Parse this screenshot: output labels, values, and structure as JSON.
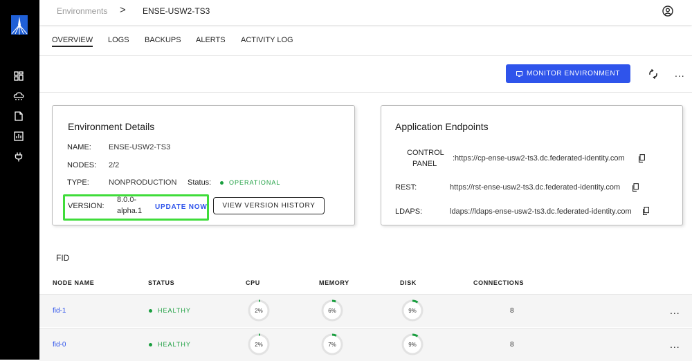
{
  "breadcrumb": {
    "parent": "Environments",
    "separator": ">",
    "current": "ENSE-USW2-TS3"
  },
  "tabs": [
    {
      "label": "OVERVIEW",
      "active": true
    },
    {
      "label": "LOGS"
    },
    {
      "label": "BACKUPS"
    },
    {
      "label": "ALERTS"
    },
    {
      "label": "ACTIVITY LOG"
    }
  ],
  "actions": {
    "monitor_label": "MONITOR ENVIRONMENT",
    "more": "..."
  },
  "env_details": {
    "title": "Environment Details",
    "name_label": "NAME:",
    "name_value": "ENSE-USW2-TS3",
    "nodes_label": "NODES:",
    "nodes_value": "2/2",
    "type_label": "TYPE:",
    "type_value": "NONPRODUCTION",
    "status_label": "Status:",
    "status_value": "OPERATIONAL",
    "version_label": "VERSION:",
    "version_value_line1": "8.0.0-",
    "version_value_line2": "alpha.1",
    "update_label": "UPDATE NOW",
    "history_label": "VIEW VERSION HISTORY"
  },
  "endpoints": {
    "title": "Application Endpoints",
    "control_label_line1": "CONTROL",
    "control_label_line2": "PANEL",
    "control_value": ":https://cp-ense-usw2-ts3.dc.federated-identity.com",
    "rest_label": "REST:",
    "rest_value": "https://rst-ense-usw2-ts3.dc.federated-identity.com",
    "ldaps_label": "LDAPS:",
    "ldaps_value": "ldaps://ldaps-ense-usw2-ts3.dc.federated-identity.com"
  },
  "fid": {
    "title": "FID",
    "columns": [
      "NODE NAME",
      "STATUS",
      "CPU",
      "MEMORY",
      "DISK",
      "CONNECTIONS"
    ],
    "rows": [
      {
        "name": "fid-1",
        "status": "HEALTHY",
        "cpu": "2%",
        "memory": "6%",
        "disk": "9%",
        "cpu_pct": 2,
        "memory_pct": 6,
        "disk_pct": 9,
        "connections": "8",
        "more": "..."
      },
      {
        "name": "fid-0",
        "status": "HEALTHY",
        "cpu": "2%",
        "memory": "7%",
        "disk": "9%",
        "cpu_pct": 2,
        "memory_pct": 7,
        "disk_pct": 9,
        "connections": "8",
        "more": "..."
      }
    ]
  },
  "colors": {
    "accent": "#2f54eb",
    "healthy": "#1a9e3f",
    "highlight": "#3fdc3a",
    "sidebar": "#000000"
  },
  "icons": [
    "logo-icon",
    "dashboard-icon",
    "cloud-icon",
    "document-icon",
    "chart-icon",
    "plug-icon",
    "user-icon",
    "refresh-icon",
    "copy-icon",
    "monitor-icon"
  ]
}
